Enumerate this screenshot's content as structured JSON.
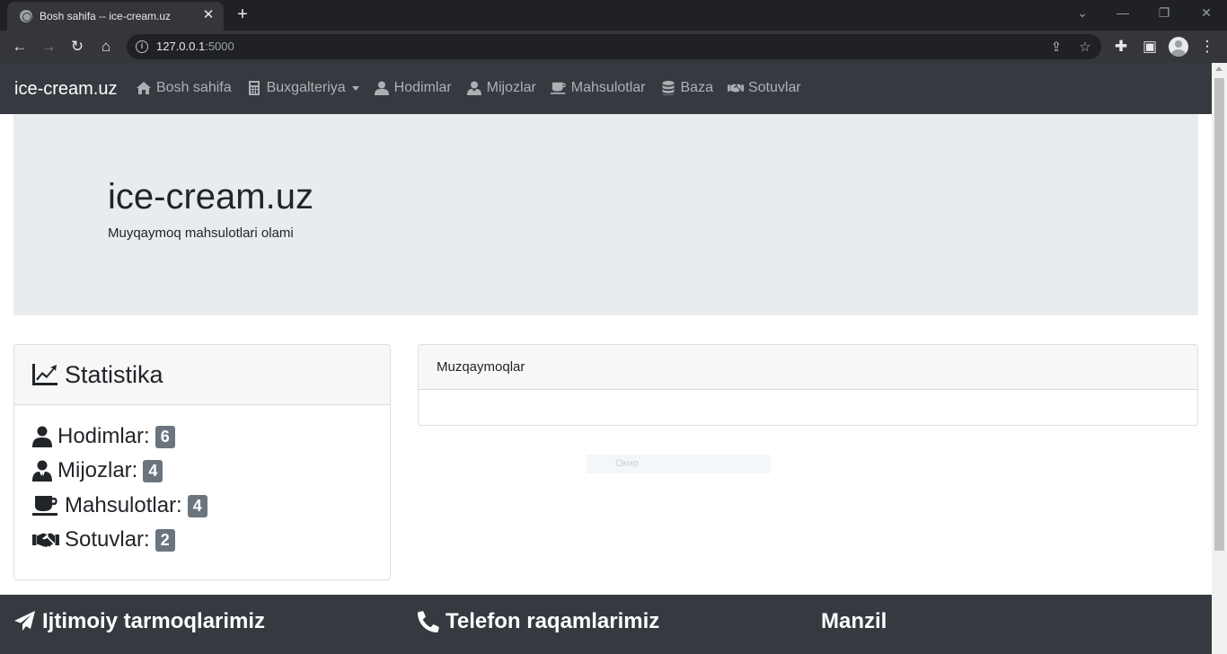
{
  "browser": {
    "tab_title": "Bosh sahifa -- ice-cream.uz",
    "tab_close": "✕",
    "new_tab": "+",
    "url_host": "127.0.0.1",
    "url_port": ":5000"
  },
  "navbar": {
    "brand": "ice-cream.uz",
    "items": [
      {
        "label": "Bosh sahifa",
        "icon": "home-icon"
      },
      {
        "label": "Buxgalteriya",
        "icon": "calculator-icon",
        "dropdown": true
      },
      {
        "label": "Hodimlar",
        "icon": "user-icon"
      },
      {
        "label": "Mijozlar",
        "icon": "user-tie-icon"
      },
      {
        "label": "Mahsulotlar",
        "icon": "coffee-icon"
      },
      {
        "label": "Baza",
        "icon": "database-icon"
      },
      {
        "label": "Sotuvlar",
        "icon": "handshake-icon"
      }
    ]
  },
  "jumbotron": {
    "title": "ice-cream.uz",
    "lead": "Muyqaymoq mahsulotlari olami"
  },
  "stats": {
    "title": "Statistika",
    "rows": [
      {
        "label": "Hodimlar:",
        "count": "6",
        "icon": "user-icon"
      },
      {
        "label": "Mijozlar:",
        "count": "4",
        "icon": "user-tie-icon"
      },
      {
        "label": "Mahsulotlar:",
        "count": "4",
        "icon": "coffee-icon"
      },
      {
        "label": "Sotuvlar:",
        "count": "2",
        "icon": "handshake-icon"
      }
    ]
  },
  "ice_cream_card": {
    "title": "Muzqaymoqlar"
  },
  "ghost_tooltip": "Окно",
  "footer": {
    "social": "Ijtimoiy tarmoqlarimiz",
    "phone": "Telefon raqamlarimiz",
    "address": "Manzil"
  },
  "colors": {
    "navbar_bg": "#343a40",
    "jumbotron_bg": "#e9ecef",
    "badge_bg": "#6c757d"
  }
}
